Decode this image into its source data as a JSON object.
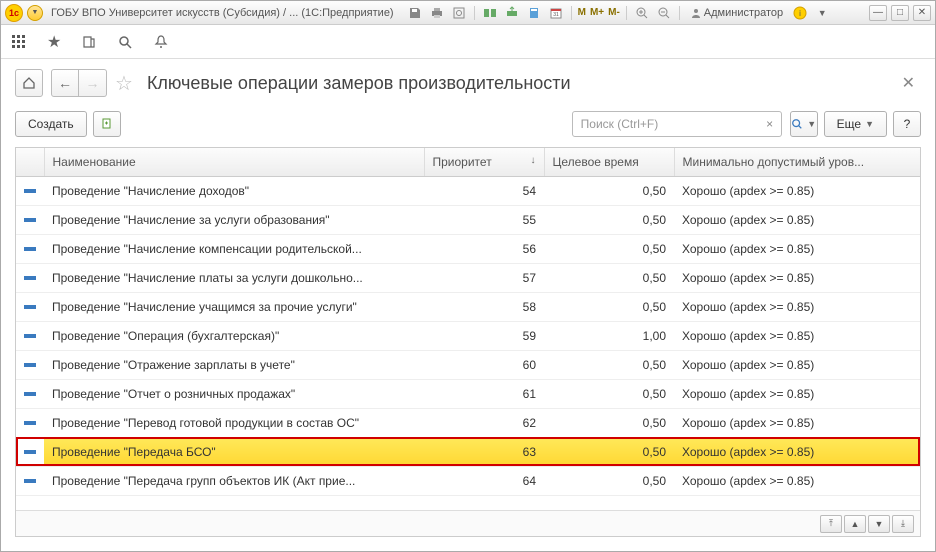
{
  "titlebar": {
    "title": "ГОБУ ВПО Университет искусств (Субсидия) / ... (1С:Предприятие)",
    "user_label": "Администратор",
    "m_label": "M",
    "m_plus": "M+",
    "m_minus": "M-"
  },
  "page": {
    "title": "Ключевые операции замеров производительности"
  },
  "actions": {
    "create": "Создать",
    "more": "Еще",
    "help": "?"
  },
  "search": {
    "placeholder": "Поиск (Ctrl+F)",
    "value": ""
  },
  "table": {
    "columns": {
      "name": "Наименование",
      "priority": "Приоритет",
      "target_time": "Целевое время",
      "min_level": "Минимально допустимый уров..."
    },
    "rows": [
      {
        "name": "Проведение \"Начисление доходов\"",
        "priority": "54",
        "target_time": "0,50",
        "min_level": "Хорошо (apdex >= 0.85)",
        "selected": false
      },
      {
        "name": "Проведение \"Начисление за услуги образования\"",
        "priority": "55",
        "target_time": "0,50",
        "min_level": "Хорошо (apdex >= 0.85)",
        "selected": false
      },
      {
        "name": "Проведение \"Начисление компенсации родительской...",
        "priority": "56",
        "target_time": "0,50",
        "min_level": "Хорошо (apdex >= 0.85)",
        "selected": false
      },
      {
        "name": "Проведение \"Начисление платы за услуги дошкольно...",
        "priority": "57",
        "target_time": "0,50",
        "min_level": "Хорошо (apdex >= 0.85)",
        "selected": false
      },
      {
        "name": "Проведение \"Начисление учащимся за прочие услуги\"",
        "priority": "58",
        "target_time": "0,50",
        "min_level": "Хорошо (apdex >= 0.85)",
        "selected": false
      },
      {
        "name": "Проведение \"Операция (бухгалтерская)\"",
        "priority": "59",
        "target_time": "1,00",
        "min_level": "Хорошо (apdex >= 0.85)",
        "selected": false
      },
      {
        "name": "Проведение \"Отражение зарплаты в учете\"",
        "priority": "60",
        "target_time": "0,50",
        "min_level": "Хорошо (apdex >= 0.85)",
        "selected": false
      },
      {
        "name": "Проведение \"Отчет о розничных продажах\"",
        "priority": "61",
        "target_time": "0,50",
        "min_level": "Хорошо (apdex >= 0.85)",
        "selected": false
      },
      {
        "name": "Проведение \"Перевод готовой продукции в состав ОС\"",
        "priority": "62",
        "target_time": "0,50",
        "min_level": "Хорошо (apdex >= 0.85)",
        "selected": false
      },
      {
        "name": "Проведение \"Передача БСО\"",
        "priority": "63",
        "target_time": "0,50",
        "min_level": "Хорошо (apdex >= 0.85)",
        "selected": true
      },
      {
        "name": "Проведение \"Передача групп объектов ИК (Акт прие...",
        "priority": "64",
        "target_time": "0,50",
        "min_level": "Хорошо (apdex >= 0.85)",
        "selected": false
      }
    ]
  }
}
